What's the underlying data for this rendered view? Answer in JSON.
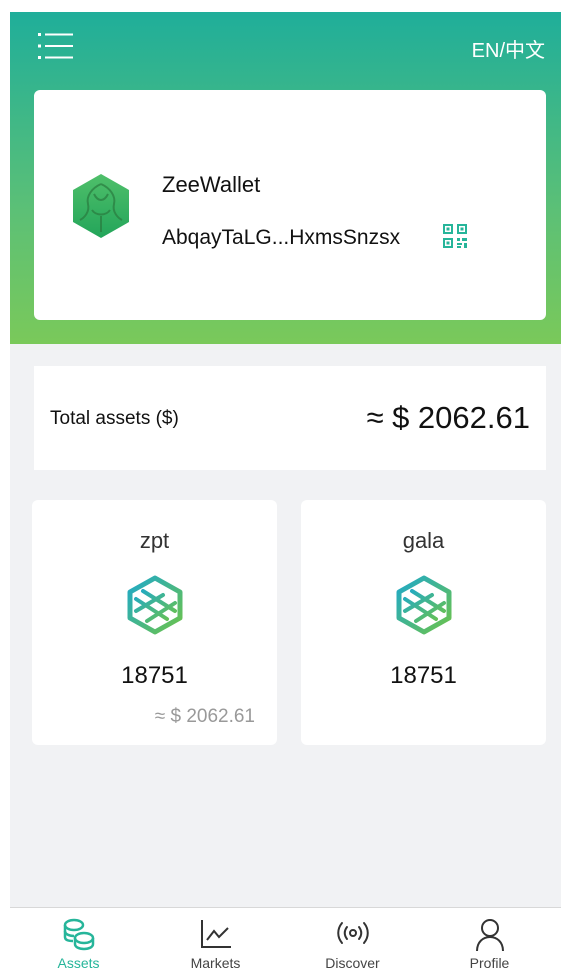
{
  "header": {
    "menu_icon": "menu-list-icon",
    "language_label": "EN/中文"
  },
  "wallet": {
    "logo_icon": "wallet-logo-icon",
    "name": "ZeeWallet",
    "address": "AbqayTaLG...HxmsSnzsx",
    "qr_icon": "qr-code-icon"
  },
  "total": {
    "label": "Total assets ($)",
    "value": "≈ $ 2062.61"
  },
  "assets": [
    {
      "name": "zpt",
      "amount": "18751",
      "usd": "≈ $ 2062.61",
      "icon": "zpt-token-icon"
    },
    {
      "name": "gala",
      "amount": "18751",
      "usd": "",
      "icon": "gala-token-icon"
    }
  ],
  "tabbar": {
    "items": [
      {
        "label": "Assets",
        "icon": "coins-icon",
        "active": true
      },
      {
        "label": "Markets",
        "icon": "line-chart-icon",
        "active": false
      },
      {
        "label": "Discover",
        "icon": "broadcast-icon",
        "active": false
      },
      {
        "label": "Profile",
        "icon": "person-icon",
        "active": false
      }
    ]
  },
  "colors": {
    "header_top": "#1fae9a",
    "header_bottom": "#7ac95a",
    "accent": "#26b59a",
    "background": "#f1f2f4"
  }
}
